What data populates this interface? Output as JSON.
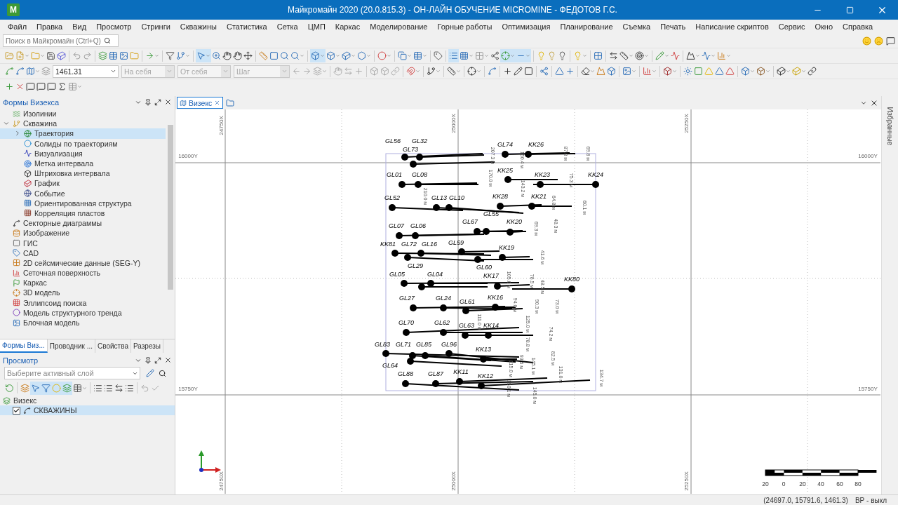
{
  "window": {
    "title": "Майкромайн 2020 (20.0.815.3) - ОН-ЛАЙН ОБУЧЕНИЕ MICROMINE - ФЕДОТОВ Г.С.",
    "logo": "M"
  },
  "menu": [
    "Файл",
    "Правка",
    "Вид",
    "Просмотр",
    "Стринги",
    "Скважины",
    "Статистика",
    "Сетка",
    "ЦМП",
    "Каркас",
    "Моделирование",
    "Горные работы",
    "Оптимизация",
    "Планирование",
    "Съемка",
    "Печать",
    "Написание скриптов",
    "Сервис",
    "Окно",
    "Справка"
  ],
  "search": {
    "placeholder": "Поиск в Майкромайн (Ctrl+Q)"
  },
  "toolbar": {
    "elevation": {
      "value": "1461.31"
    },
    "fields": [
      {
        "placeholder": "На себя",
        "disabled": true
      },
      {
        "placeholder": "От себя",
        "disabled": true
      },
      {
        "placeholder": "Шаг",
        "disabled": true
      }
    ]
  },
  "forms_panel": {
    "title": "Формы Визекса",
    "items": [
      {
        "label": "Изолинии",
        "selected": false
      },
      {
        "label": "Скважина",
        "selected": false,
        "expanded": true,
        "children": [
          {
            "label": "Траектория",
            "selected": true,
            "expanded": false
          },
          {
            "label": "Солиды по траекториям",
            "selected": false
          },
          {
            "label": "Визуализация",
            "selected": false
          },
          {
            "label": "Метка интервала",
            "selected": false
          },
          {
            "label": "Штриховка интервала",
            "selected": false
          },
          {
            "label": "График",
            "selected": false
          },
          {
            "label": "Событие",
            "selected": false
          },
          {
            "label": "Ориентированная структура",
            "selected": false
          },
          {
            "label": "Корреляция пластов",
            "selected": false
          }
        ]
      },
      {
        "label": "Секторные диаграммы",
        "selected": false
      },
      {
        "label": "Изображение",
        "selected": false
      },
      {
        "label": "ГИС",
        "selected": false
      },
      {
        "label": "CAD",
        "selected": false
      },
      {
        "label": "2D сейсмические данные (SEG-Y)",
        "selected": false
      },
      {
        "label": "Сеточная поверхность",
        "selected": false
      },
      {
        "label": "Каркас",
        "selected": false
      },
      {
        "label": "3D модель",
        "selected": false
      },
      {
        "label": "Эллипсоид поиска",
        "selected": false
      },
      {
        "label": "Модель структурного тренда",
        "selected": false
      },
      {
        "label": "Блочная модель",
        "selected": false
      }
    ]
  },
  "panel_tabs": [
    {
      "label": "Формы Виз...",
      "selected": true
    },
    {
      "label": "Проводник ...",
      "selected": false
    },
    {
      "label": "Свойства",
      "selected": false
    },
    {
      "label": "Разрезы",
      "selected": false
    }
  ],
  "preview_panel": {
    "title": "Просмотр",
    "layer_field": {
      "placeholder": "Выберите активный слой"
    },
    "items": [
      {
        "label": "Визекс",
        "selected": false,
        "children": [
          {
            "label": "СКВАЖИНЫ",
            "checked": true,
            "selected": true
          }
        ]
      }
    ]
  },
  "doc_tabs": [
    {
      "label": "Визекс",
      "selected": true
    }
  ],
  "side_strip": {
    "label": "Избранные"
  },
  "map": {
    "grid_labels": [
      "24750X",
      "25000X",
      "25250X",
      "16000Y",
      "16000Y",
      "15750Y",
      "15750Y",
      "24750X",
      "25000X",
      "25250X"
    ],
    "holes": [
      {
        "label": "GL56"
      },
      {
        "label": "GL32"
      },
      {
        "label": "GL73"
      },
      {
        "label": "GL74"
      },
      {
        "label": "KK26"
      },
      {
        "label": "GL01"
      },
      {
        "label": "GL08"
      },
      {
        "label": "KK25"
      },
      {
        "label": "KK23"
      },
      {
        "label": "KK24"
      },
      {
        "label": "GL52"
      },
      {
        "label": "GL13"
      },
      {
        "label": "GL10"
      },
      {
        "label": "KK28"
      },
      {
        "label": "KK21"
      },
      {
        "label": "GL07"
      },
      {
        "label": "GL06"
      },
      {
        "label": "GL67"
      },
      {
        "label": "GL55"
      },
      {
        "label": "KK20"
      },
      {
        "label": "KK81"
      },
      {
        "label": "GL72"
      },
      {
        "label": "GL16"
      },
      {
        "label": "GL59"
      },
      {
        "label": "KK19"
      },
      {
        "label": "GL05"
      },
      {
        "label": "GL29"
      },
      {
        "label": "GL04"
      },
      {
        "label": "GL60"
      },
      {
        "label": "KK17"
      },
      {
        "label": "KK80"
      },
      {
        "label": "GL27"
      },
      {
        "label": "GL24"
      },
      {
        "label": "GL61"
      },
      {
        "label": "KK16"
      },
      {
        "label": "GL70"
      },
      {
        "label": "GL62"
      },
      {
        "label": "GL63"
      },
      {
        "label": "KK14"
      },
      {
        "label": "GL83"
      },
      {
        "label": "GL71"
      },
      {
        "label": "GL85"
      },
      {
        "label": "GL96"
      },
      {
        "label": "KK13"
      },
      {
        "label": "GL64"
      },
      {
        "label": "GL88"
      },
      {
        "label": "GL87"
      },
      {
        "label": "KK11"
      },
      {
        "label": "KK12"
      }
    ],
    "lengths": [
      "207.3 м",
      "150.4 м",
      "87.8 м",
      "69.8 м",
      "210.0 м",
      "170.0 м",
      "143.2 м",
      "75.3 м",
      "64.8 м",
      "60.1 м",
      "48.3 м",
      "69.3 м",
      "41.6 м",
      "78.5 м",
      "48.5 м",
      "105.0 м",
      "111.0 м",
      "94.0 м",
      "90.3 м",
      "73.0 м",
      "125.0 м",
      "74.2 м",
      "78.8 м",
      "93.5 м",
      "145.1 м",
      "82.5 м",
      "131.0 м",
      "115.0 м",
      "134.7 м",
      "150.1 м",
      "145.0 м"
    ],
    "scale_ticks": [
      "20",
      "0",
      "20",
      "40",
      "60",
      "80"
    ]
  },
  "status_bar": {
    "coordinates": "(24697.0, 15791.6, 1461.3)",
    "mode": "ВР - выкл"
  }
}
